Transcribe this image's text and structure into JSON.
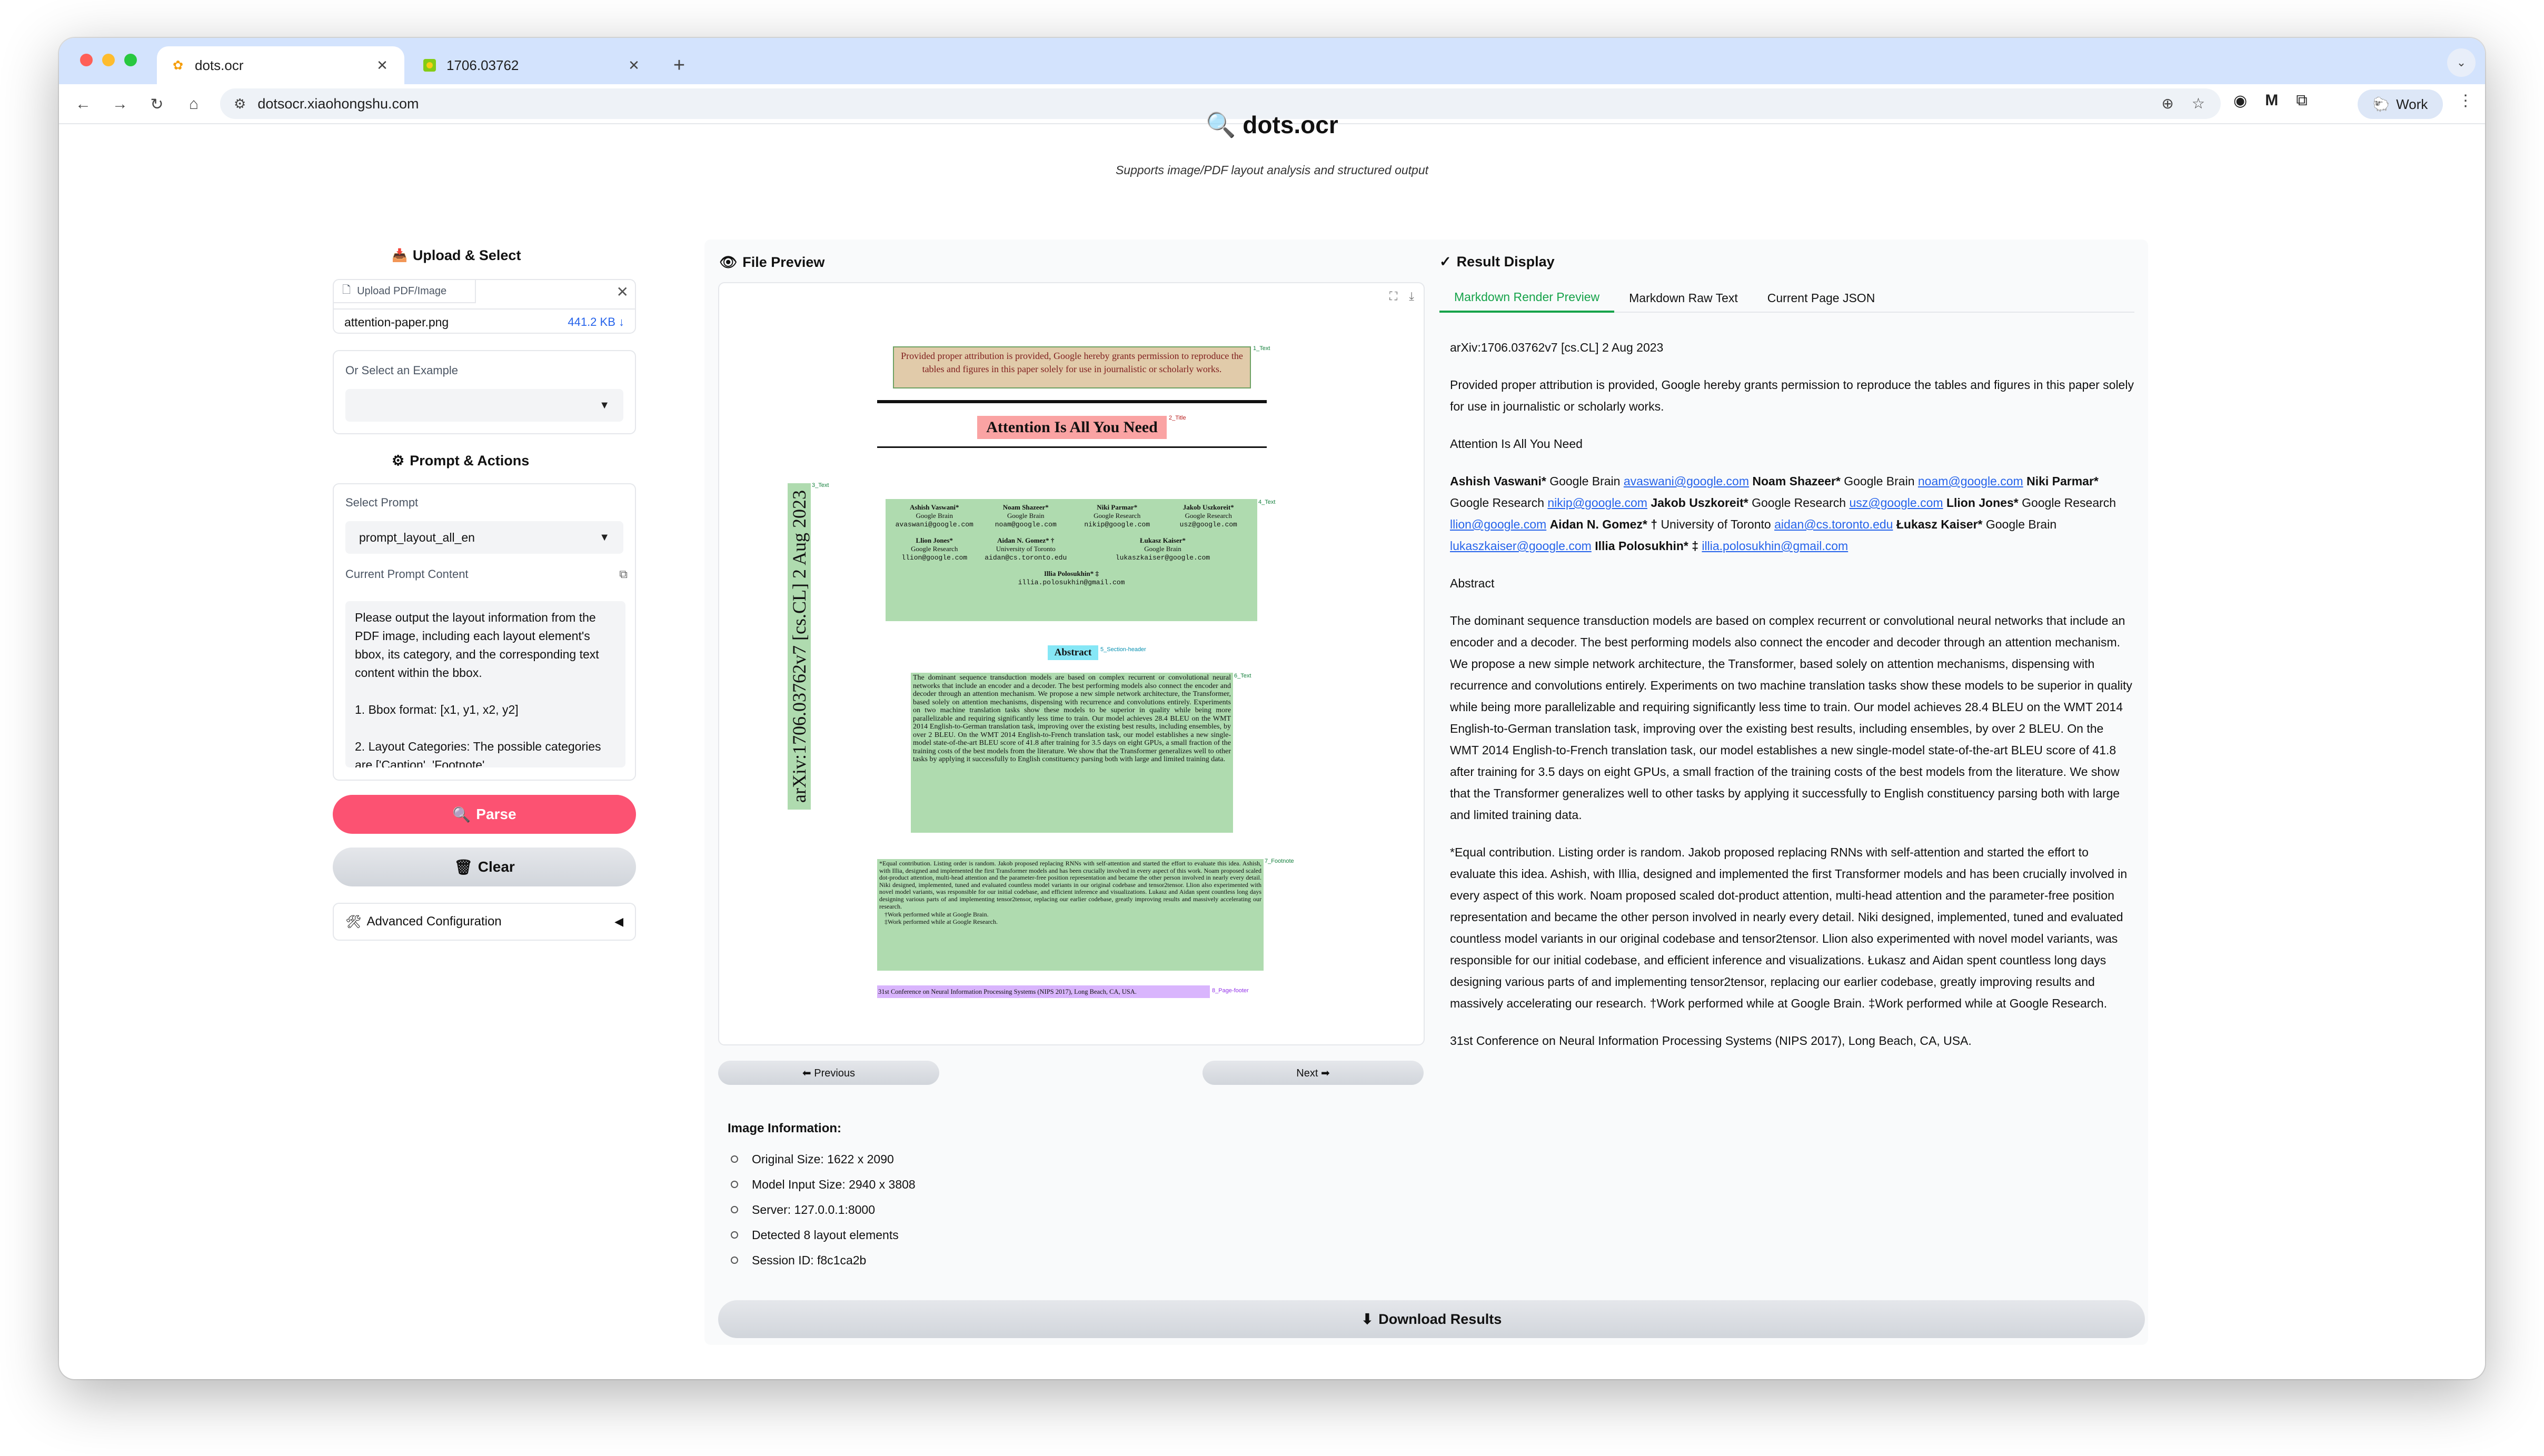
{
  "browser": {
    "tabs": [
      {
        "title": "dots.ocr",
        "icon": "ocr-favicon-icon",
        "active": true
      },
      {
        "title": "1706.03762",
        "icon": "arxiv-favicon-icon",
        "active": false
      }
    ],
    "url": "dotsocr.xiaohongshu.com",
    "profile_label": "Work"
  },
  "page": {
    "title_icon": "🔍",
    "title": "dots.ocr",
    "subtitle": "Supports image/PDF layout analysis and structured output"
  },
  "upload": {
    "heading": "Upload & Select",
    "box_label": "Upload PDF/Image",
    "file_name": "attention-paper.png",
    "file_size": "441.2 KB ↓",
    "example_label": "Or Select an Example",
    "example_value": ""
  },
  "prompt": {
    "heading": "Prompt & Actions",
    "select_label": "Select Prompt",
    "select_value": "prompt_layout_all_en",
    "content_label": "Current Prompt Content",
    "content": "Please output the layout information from the PDF image, including each layout element's bbox, its category, and the corresponding text content within the bbox.\n\n1. Bbox format: [x1, y1, x2, y2]\n\n2. Layout Categories: The possible categories are ['Caption', 'Footnote',"
  },
  "actions": {
    "parse_label": "Parse",
    "clear_label": "Clear",
    "advanced_label": "Advanced Configuration"
  },
  "preview": {
    "heading": "File Preview",
    "prev_label": "⬅ Previous",
    "next_label": "Next ➡",
    "paper": {
      "permission": "Provided proper attribution is provided, Google hereby grants permission to reproduce the tables and figures in this paper solely for use in journalistic or scholarly works.",
      "title": "Attention Is All You Need",
      "arxiv_side": "arXiv:1706.03762v7 [cs.CL] 2 Aug 2023",
      "authors": [
        {
          "name": "Ashish Vaswani*",
          "org": "Google Brain",
          "email": "avaswani@google.com"
        },
        {
          "name": "Noam Shazeer*",
          "org": "Google Brain",
          "email": "noam@google.com"
        },
        {
          "name": "Niki Parmar*",
          "org": "Google Research",
          "email": "nikip@google.com"
        },
        {
          "name": "Jakob Uszkoreit*",
          "org": "Google Research",
          "email": "usz@google.com"
        },
        {
          "name": "Llion Jones*",
          "org": "Google Research",
          "email": "llion@google.com"
        },
        {
          "name": "Aidan N. Gomez* †",
          "org": "University of Toronto",
          "email": "aidan@cs.toronto.edu"
        },
        {
          "name": "Łukasz Kaiser*",
          "org": "Google Brain",
          "email": "lukaszkaiser@google.com"
        },
        {
          "name": "Illia Polosukhin* ‡",
          "org": "",
          "email": "illia.polosukhin@gmail.com"
        }
      ],
      "abstract_heading": "Abstract",
      "abstract": "The dominant sequence transduction models are based on complex recurrent or convolutional neural networks that include an encoder and a decoder. The best performing models also connect the encoder and decoder through an attention mechanism. We propose a new simple network architecture, the Transformer, based solely on attention mechanisms, dispensing with recurrence and convolutions entirely. Experiments on two machine translation tasks show these models to be superior in quality while being more parallelizable and requiring significantly less time to train. Our model achieves 28.4 BLEU on the WMT 2014 English-to-German translation task, improving over the existing best results, including ensembles, by over 2 BLEU. On the WMT 2014 English-to-French translation task, our model establishes a new single-model state-of-the-art BLEU score of 41.8 after training for 3.5 days on eight GPUs, a small fraction of the training costs of the best models from the literature. We show that the Transformer generalizes well to other tasks by applying it successfully to English constituency parsing both with large and limited training data.",
      "footnote": "*Equal contribution. Listing order is random. Jakob proposed replacing RNNs with self-attention and started the effort to evaluate this idea. Ashish, with Illia, designed and implemented the first Transformer models and has been crucially involved in every aspect of this work. Noam proposed scaled dot-product attention, multi-head attention and the parameter-free position representation and became the other person involved in nearly every detail. Niki designed, implemented, tuned and evaluated countless model variants in our original codebase and tensor2tensor. Llion also experimented with novel model variants, was responsible for our initial codebase, and efficient inference and visualizations. Lukasz and Aidan spent countless long days designing various parts of and implementing tensor2tensor, replacing our earlier codebase, greatly improving results and massively accelerating our research.",
      "footnote_2": "†Work performed while at Google Brain.",
      "footnote_3": "‡Work performed while at Google Research.",
      "page_footer": "31st Conference on Neural Information Processing Systems (NIPS 2017), Long Beach, CA, USA.",
      "tags": {
        "permission": "1_Text",
        "title": "2_Title",
        "side": "3_Text",
        "authors": "4_Text",
        "abstract_heading": "5_Section-header",
        "abstract": "6_Text",
        "footnote": "7_Footnote",
        "page_footer": "8_Page-footer"
      }
    }
  },
  "image_info": {
    "heading": "Image Information:",
    "items": [
      "Original Size: 1622 x 2090",
      "Model Input Size: 2940 x 3808",
      "Server: 127.0.0.1:8000",
      "Detected 8 layout elements",
      "Session ID: f8c1ca2b"
    ]
  },
  "download_label": "Download Results",
  "result": {
    "heading": "Result Display",
    "tabs": [
      "Markdown Render Preview",
      "Markdown Raw Text",
      "Current Page JSON"
    ],
    "arxiv": "arXiv:1706.03762v7 [cs.CL] 2 Aug 2023",
    "permission": "Provided proper attribution is provided, Google hereby grants permission to reproduce the tables and figures in this paper solely for use in journalistic or scholarly works.",
    "title": "Attention Is All You Need",
    "authors": [
      {
        "name": "Ashish Vaswani*",
        "org": "Google Brain",
        "email": "avaswani@google.com"
      },
      {
        "name": "Noam Shazeer*",
        "org": "Google Brain",
        "email": "noam@google.com"
      },
      {
        "name": "Niki Parmar*",
        "org": "Google Research",
        "email": "nikip@google.com"
      },
      {
        "name": "Jakob Uszkoreit*",
        "org": "Google Research",
        "email": "usz@google.com"
      },
      {
        "name": "Llion Jones*",
        "org": "Google Research",
        "email": "llion@google.com"
      },
      {
        "name": "Aidan N. Gomez* †",
        "org": "University of Toronto",
        "email": "aidan@cs.toronto.edu"
      },
      {
        "name": "Łukasz Kaiser*",
        "org": "Google Brain",
        "email": "lukaszkaiser@google.com"
      },
      {
        "name": "Illia Polosukhin* ‡",
        "org": "",
        "email": "illia.polosukhin@gmail.com"
      }
    ],
    "abstract_heading": "Abstract",
    "abstract": "The dominant sequence transduction models are based on complex recurrent or convolutional neural networks that include an encoder and a decoder. The best performing models also connect the encoder and decoder through an attention mechanism. We propose a new simple network architecture, the Transformer, based solely on attention mechanisms, dispensing with recurrence and convolutions entirely. Experiments on two machine translation tasks show these models to be superior in quality while being more parallelizable and requiring significantly less time to train. Our model achieves 28.4 BLEU on the WMT 2014 English-to-German translation task, improving over the existing best results, including ensembles, by over 2 BLEU. On the WMT 2014 English-to-French translation task, our model establishes a new single-model state-of-the-art BLEU score of 41.8 after training for 3.5 days on eight GPUs, a small fraction of the training costs of the best models from the literature. We show that the Transformer generalizes well to other tasks by applying it successfully to English constituency parsing both with large and limited training data.",
    "footnote": "*Equal contribution. Listing order is random. Jakob proposed replacing RNNs with self-attention and started the effort to evaluate this idea. Ashish, with Illia, designed and implemented the first Transformer models and has been crucially involved in every aspect of this work. Noam proposed scaled dot-product attention, multi-head attention and the parameter-free position representation and became the other person involved in nearly every detail. Niki designed, implemented, tuned and evaluated countless model variants in our original codebase and tensor2tensor. Llion also experimented with novel model variants, was responsible for our initial codebase, and efficient inference and visualizations. Łukasz and Aidan spent countless long days designing various parts of and implementing tensor2tensor, replacing our earlier codebase, greatly improving results and massively accelerating our research. †Work performed while at Google Brain. ‡Work performed while at Google Research.",
    "page_footer": "31st Conference on Neural Information Processing Systems (NIPS 2017), Long Beach, CA, USA."
  },
  "colors": {
    "accent": "#fc5272",
    "tab_active": "#16a34a",
    "link": "#2563eb",
    "highlight_text": "#6ebe6e",
    "highlight_title": "#f87171",
    "highlight_section": "#22d3ee",
    "highlight_footer": "#c084fc"
  }
}
